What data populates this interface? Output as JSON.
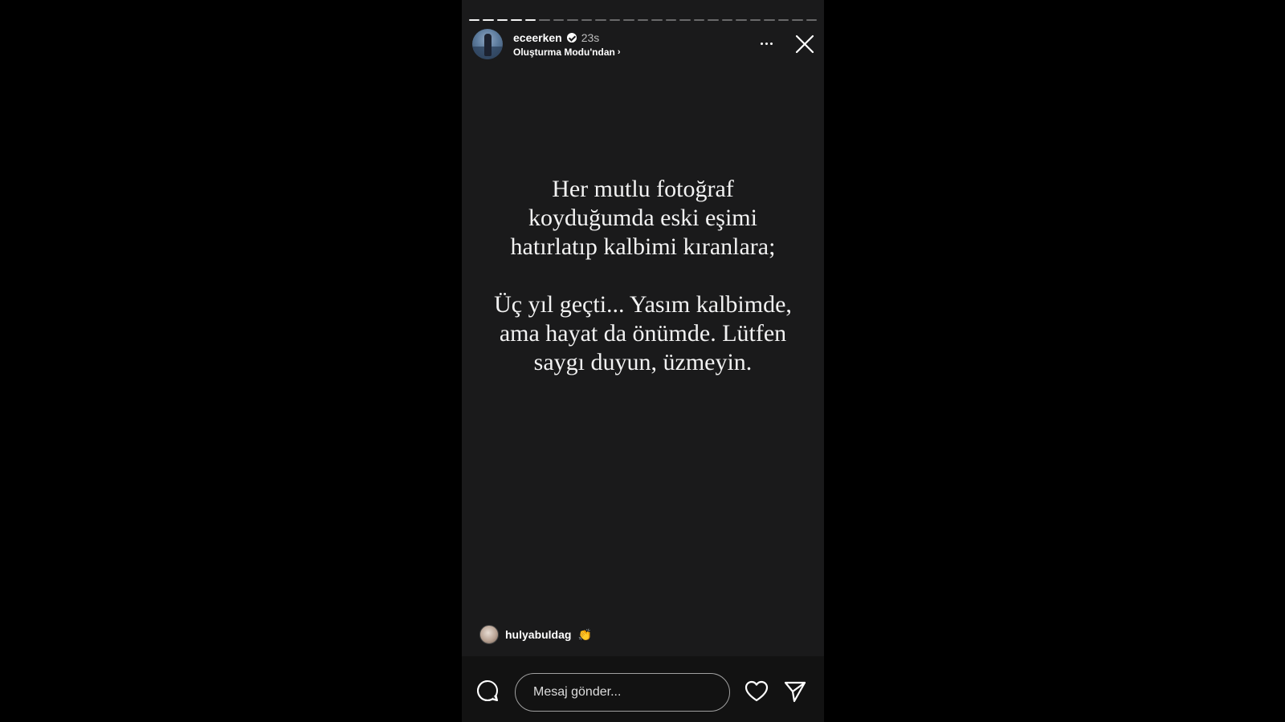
{
  "story": {
    "progress_total": 25,
    "progress_completed": 5,
    "header": {
      "username": "eceerken",
      "verified": true,
      "time": "23s",
      "source": "Oluşturma Modu'ndan",
      "icons": [
        "verified-badge-icon",
        "chevron-right-icon",
        "more-icon",
        "close-icon"
      ]
    },
    "text": {
      "paragraph1": [
        "Her mutlu fotoğraf",
        "koyduğumda eski eşimi",
        "hatırlatıp kalbimi kıranlara;"
      ],
      "paragraph2": [
        "Üç yıl geçti... Yasım kalbimde,",
        "ama hayat da önümde. Lütfen",
        "saygı duyun, üzmeyin."
      ]
    },
    "liker": {
      "username": "hulyabuldag",
      "emoji": "👏"
    },
    "footer": {
      "message_placeholder": "Mesaj gönder...",
      "message_value": "",
      "icons": [
        "comment-icon",
        "heart-icon",
        "send-icon"
      ]
    }
  },
  "colors": {
    "page_background": "#000000",
    "story_background": "#1a1a1b",
    "text": "#f2f2f2",
    "accent": "#ffffff"
  }
}
